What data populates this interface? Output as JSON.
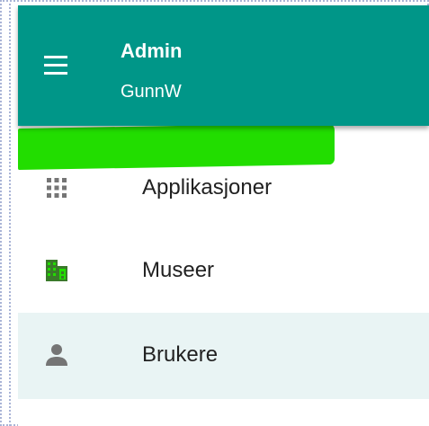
{
  "toolbar": {
    "title": "Admin",
    "subtitle": "GunnW",
    "menu_icon": "hamburger-menu-icon",
    "background_color": "#009688"
  },
  "nav": {
    "items": [
      {
        "label": "Applikasjoner",
        "icon": "apps-grid-icon"
      },
      {
        "label": "Museer",
        "icon": "building-icon",
        "highlight_color": "#22dd00"
      },
      {
        "label": "Brukere",
        "icon": "person-icon",
        "selected_background": "#e9f4f4"
      }
    ]
  }
}
